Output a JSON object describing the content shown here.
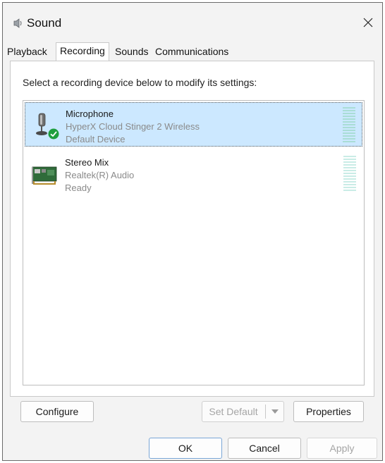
{
  "window": {
    "title": "Sound",
    "icon": "speaker-icon"
  },
  "tabs": [
    {
      "label": "Playback",
      "active": false
    },
    {
      "label": "Recording",
      "active": true
    },
    {
      "label": "Sounds",
      "active": false
    },
    {
      "label": "Communications",
      "active": false
    }
  ],
  "recording": {
    "instruction": "Select a recording device below to modify its settings:",
    "devices": [
      {
        "name": "Microphone",
        "description": "HyperX Cloud Stinger 2 Wireless",
        "status": "Default Device",
        "icon": "microphone-icon",
        "badge": "default-check-icon",
        "selected": true
      },
      {
        "name": "Stereo Mix",
        "description": "Realtek(R) Audio",
        "status": "Ready",
        "icon": "sound-card-icon",
        "selected": false
      }
    ]
  },
  "buttons": {
    "configure": "Configure",
    "set_default": "Set Default",
    "properties": "Properties",
    "ok": "OK",
    "cancel": "Cancel",
    "apply": "Apply"
  },
  "colors": {
    "selection": "#cce8ff",
    "check_badge": "#1e9e3e",
    "level_meter": "#a9ddd6"
  }
}
